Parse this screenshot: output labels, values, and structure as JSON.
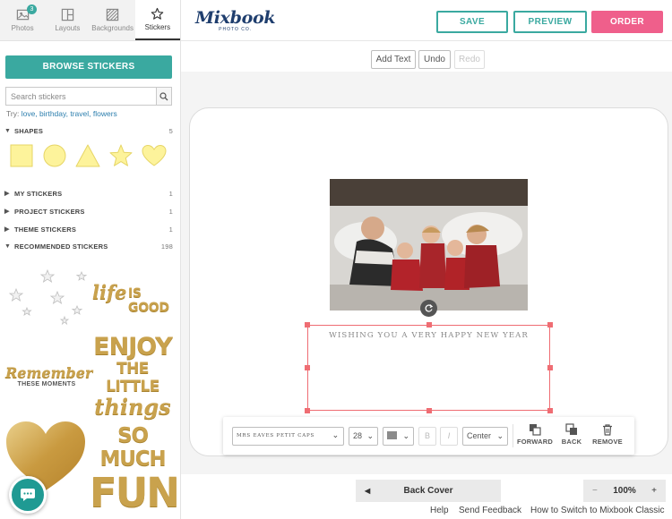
{
  "sidebar": {
    "tabs": [
      {
        "label": "Photos",
        "badge": "3",
        "icon": "photos-icon"
      },
      {
        "label": "Layouts",
        "icon": "layouts-icon"
      },
      {
        "label": "Backgrounds",
        "icon": "backgrounds-icon"
      },
      {
        "label": "Stickers",
        "icon": "star-icon",
        "active": true
      }
    ],
    "browse_label": "BROWSE STICKERS",
    "search_placeholder": "Search stickers",
    "try_prefix": "Try:",
    "try_keywords": "love, birthday, travel, flowers",
    "sections": [
      {
        "label": "SHAPES",
        "count": "5",
        "expanded": true
      },
      {
        "label": "MY STICKERS",
        "count": "1",
        "expanded": false
      },
      {
        "label": "PROJECT STICKERS",
        "count": "1",
        "expanded": false
      },
      {
        "label": "THEME STICKERS",
        "count": "1",
        "expanded": false
      },
      {
        "label": "RECOMMENDED STICKERS",
        "count": "198",
        "expanded": true
      }
    ],
    "shapes": [
      "square",
      "circle",
      "triangle",
      "star",
      "heart"
    ],
    "shape_color": "#fdf39b",
    "stickers": {
      "life_is_good": {
        "line1": "life",
        "line2": "IS GOOD"
      },
      "enjoy": {
        "line1": "ENJOY",
        "line2": "THE LITTLE",
        "line3": "things"
      },
      "remember": {
        "line1": "Remember",
        "line2": "THESE MOMENTS"
      },
      "so_much_fun": {
        "line1": "SO MUCH",
        "line2": "FUN"
      }
    }
  },
  "header": {
    "logo_brand": "Mixbook",
    "logo_sub": "PHOTO CO.",
    "save_label": "SAVE",
    "preview_label": "PREVIEW",
    "order_label": "ORDER",
    "accent": "#3aa9a0",
    "order_color": "#ef5f8b"
  },
  "toolbar": {
    "add_text": "Add Text",
    "undo": "Undo",
    "redo": "Redo"
  },
  "canvas": {
    "text_content": "WISHING YOU A VERY HAPPY NEW YEAR",
    "selection_color": "#ef6d73"
  },
  "format_bar": {
    "font": "MRS EAVES PETIT CAPS",
    "size": "28",
    "bold": "B",
    "italic": "I",
    "align": "Center",
    "forward": "FORWARD",
    "back": "BACK",
    "remove": "REMOVE"
  },
  "bottom": {
    "back_cover": "Back Cover",
    "zoom_minus": "−",
    "zoom_value": "100%",
    "zoom_plus": "+"
  },
  "footer": {
    "help": "Help",
    "feedback": "Send Feedback",
    "switch": "How to Switch to Mixbook Classic"
  }
}
